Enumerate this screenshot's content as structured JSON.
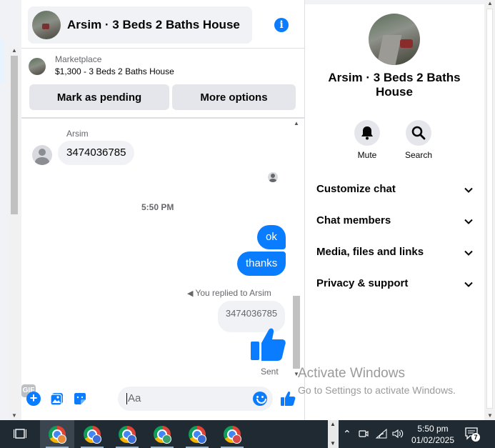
{
  "chat": {
    "title": "Arsim · 3 Beds 2 Baths House",
    "marketplace_label": "Marketplace",
    "listing": "$1,300 - 3 Beds 2 Baths House",
    "mark_pending": "Mark as pending",
    "more_options": "More options"
  },
  "messages": {
    "sender_name": "Arsim",
    "incoming_text": "3474036785",
    "timestamp": "5:50 PM",
    "out_1": "ok",
    "out_2": "thanks",
    "replied_to": "You replied to Arsim",
    "quoted_text": "3474036785",
    "status": "Sent"
  },
  "composer": {
    "placeholder": "Aa",
    "gif_label": "GIF"
  },
  "details": {
    "title": "Arsim · 3 Beds 2 Baths House",
    "mute_label": "Mute",
    "search_label": "Search",
    "menu": [
      {
        "label": "Customize chat"
      },
      {
        "label": "Chat members"
      },
      {
        "label": "Media, files and links"
      },
      {
        "label": "Privacy & support"
      }
    ]
  },
  "watermark": {
    "line1": "Activate Windows",
    "line2": "Go to Settings to activate Windows."
  },
  "taskbar": {
    "time": "5:50 pm",
    "date": "01/02/2025",
    "notification_count": "7"
  },
  "colors": {
    "accent": "#0a7cff",
    "bubble_in": "#f0f2f5",
    "taskbar": "#1f2a33"
  }
}
